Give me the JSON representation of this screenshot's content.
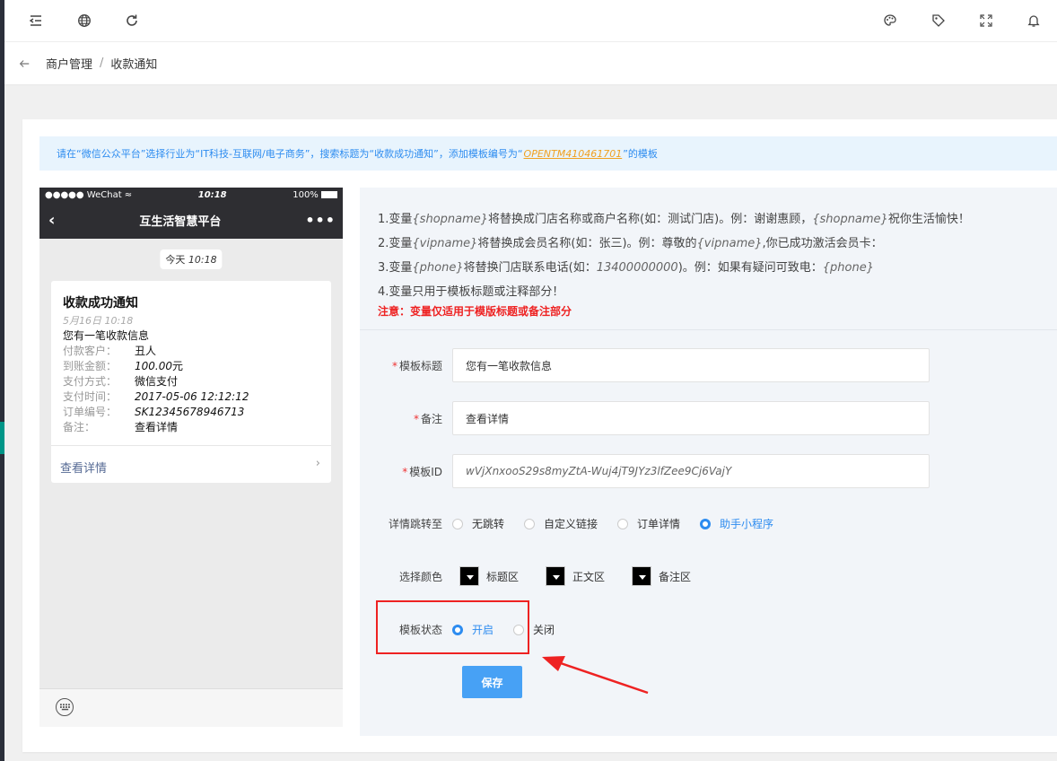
{
  "breadcrumb": {
    "parent": "商户管理",
    "separator": "/",
    "current": "收款通知"
  },
  "notice": {
    "prefix": "请在“微信公众平台”选择行业为“IT科技-互联网/电子商务”，搜索标题为“收款成功通知”，添加模板编号为“",
    "code": "OPENTM410461701",
    "suffix": "”的模板"
  },
  "phone": {
    "carrier": "●●●●● WeChat ≈",
    "time": "10:18",
    "battery": "100%",
    "nav_title": "互生活智慧平台",
    "date_pill_label": "今天",
    "date_pill_time": "10:18",
    "message": {
      "title": "收款成功通知",
      "date": "5月16日 10:18",
      "first": "您有一笔收款信息",
      "rows": [
        {
          "k": "付款客户：",
          "v": "丑人"
        },
        {
          "k": "到账金额：",
          "v": "100.00",
          "unit": "元"
        },
        {
          "k": "支付方式：",
          "v": "微信支付"
        },
        {
          "k": "支付时间：",
          "v": "2017-05-06 12:12:12"
        },
        {
          "k": "订单编号：",
          "v": "SK12345678946713"
        },
        {
          "k": "备注：",
          "v": "查看详情"
        }
      ],
      "link": "查看详情"
    }
  },
  "rules": {
    "line1": {
      "a": "1.变量",
      "v1": "{shopname}",
      "b": "将替换成门店名称或商户名称(如：测试门店)。例：谢谢惠顾，",
      "v2": "{shopname}",
      "c": "祝你生活愉快！"
    },
    "line2": {
      "a": "2.变量",
      "v1": "{vipname}",
      "b": "将替换成会员名称(如：张三)。例：尊敬的",
      "v2": "{vipname}",
      "c": ",你已成功激活会员卡："
    },
    "line3": {
      "a": "3.变量",
      "v1": "{phone}",
      "b": "将替换门店联系电话(如：",
      "num": "13400000000",
      "c": ")。例：如果有疑问可致电：",
      "v2": "{phone}"
    },
    "line4": "4.变量只用于模板标题或注释部分！",
    "warning": "注意：变量仅适用于模版标题或备注部分"
  },
  "form": {
    "title_label": "模板标题",
    "title_value": "您有一笔收款信息",
    "remark_label": "备注",
    "remark_value": "查看详情",
    "template_id_label": "模板ID",
    "template_id_value": "wVjXnxooS29s8myZtA-Wuj4jT9JYz3lfZee9Cj6VajY",
    "jump_label": "详情跳转至",
    "jump_options": [
      "无跳转",
      "自定义链接",
      "订单详情",
      "助手小程序"
    ],
    "jump_selected": "助手小程序",
    "color_label": "选择颜色",
    "color_options": [
      "标题区",
      "正文区",
      "备注区"
    ],
    "status_label": "模板状态",
    "status_options": [
      "开启",
      "关闭"
    ],
    "status_selected": "开启",
    "save_label": "保存"
  },
  "colors": {
    "accent": "#2d8cf0",
    "save_button": "#47a1f5",
    "highlight": "#ee2222",
    "required": "#e33333"
  }
}
